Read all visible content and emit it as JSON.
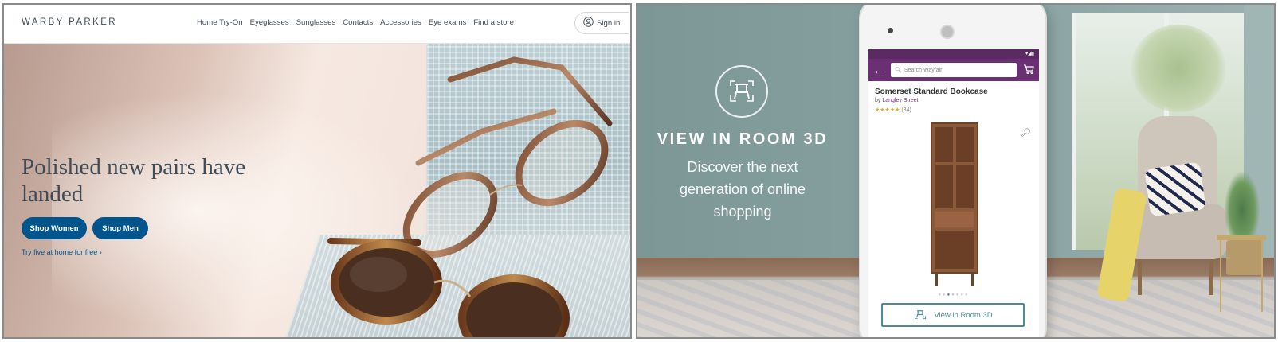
{
  "warby": {
    "logo": "WARBY PARKER",
    "nav": [
      "Home Try-On",
      "Eyeglasses",
      "Sunglasses",
      "Contacts",
      "Accessories",
      "Eye exams",
      "Find a store"
    ],
    "sign_in": "Sign in",
    "headline": "Polished new pairs have landed",
    "shop_women": "Shop Women",
    "shop_men": "Shop Men",
    "try_home": "Try five at home for free ›",
    "colors": {
      "brand_blue": "#00558c",
      "text": "#414b56"
    }
  },
  "wayfair": {
    "title": "VIEW IN ROOM 3D",
    "subtitle": "Discover the next generation of online shopping",
    "search_placeholder": "Search Wayfair",
    "product_title": "Somerset Standard Bookcase",
    "by_prefix": "by",
    "brand": "Langley Street",
    "rating_stars": "★★★★★",
    "rating_count": "(34)",
    "view_button": "View in Room 3D",
    "colors": {
      "app_bar": "#6b2f73",
      "accent_teal": "#4a8d97"
    }
  }
}
